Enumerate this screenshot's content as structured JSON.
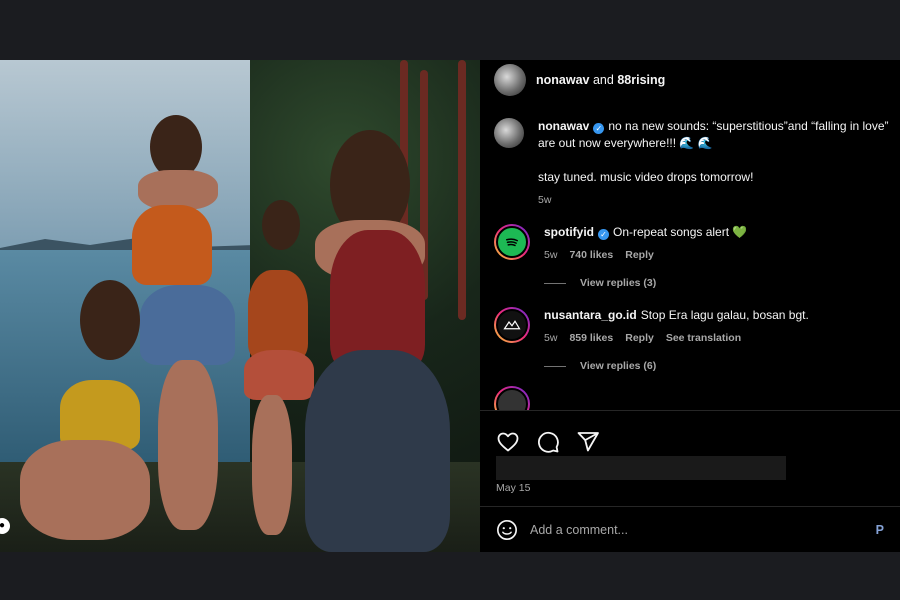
{
  "header": {
    "user1": "nonawav",
    "and": "and",
    "user2": "88rising"
  },
  "caption": {
    "user": "nonawav",
    "text": "no na new sounds: “superstitious”and “falling in love” are out now everywhere!!! 🌊 🌊",
    "text2": "stay tuned. music video drops tomorrow!",
    "time": "5w"
  },
  "comments": [
    {
      "user": "spotifyid",
      "text": "On-repeat songs alert 💚",
      "time": "5w",
      "likes": "740 likes",
      "reply": "Reply",
      "view_replies": "View replies (3)"
    },
    {
      "user": "nusantara_go.id",
      "text": "Stop Era lagu galau, bosan bgt.",
      "time": "5w",
      "likes": "859 likes",
      "reply": "Reply",
      "translation": "See translation",
      "view_replies": "View replies (6)"
    }
  ],
  "footer": {
    "date": "May 15",
    "comment_placeholder": "Add a comment...",
    "post_label": "P"
  },
  "icons": {
    "like": "heart-icon",
    "comment": "comment-icon",
    "share": "share-icon",
    "emoji": "emoji-icon"
  },
  "colors": {
    "verified": "#3797f0",
    "spotify": "#1db954",
    "link": "#85a2d6"
  }
}
